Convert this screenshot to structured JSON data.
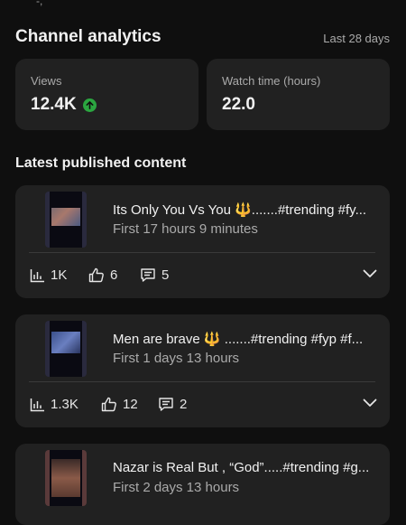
{
  "top_fragment": "-,",
  "header": {
    "title": "Channel analytics",
    "period": "Last 28 days"
  },
  "stats": {
    "views": {
      "label": "Views",
      "value": "12.4K"
    },
    "watch_time": {
      "label": "Watch time (hours)",
      "value": "22.0"
    }
  },
  "section_title": "Latest published content",
  "content": [
    {
      "title": "Its Only You Vs You 🔱.......#trending #fy...",
      "age": "First 17 hours 9 minutes",
      "views": "1K",
      "likes": "6",
      "comments": "5"
    },
    {
      "title": "Men are brave 🔱 .......#trending #fyp #f...",
      "age": "First 1 days 13 hours",
      "views": "1.3K",
      "likes": "12",
      "comments": "2"
    },
    {
      "title": "Nazar is Real But , “God”.....#trending #g...",
      "age": "First 2 days 13 hours"
    }
  ],
  "colors": {
    "background": "#0f0f0f",
    "card": "#212121",
    "up_badge": "#2ba640"
  }
}
